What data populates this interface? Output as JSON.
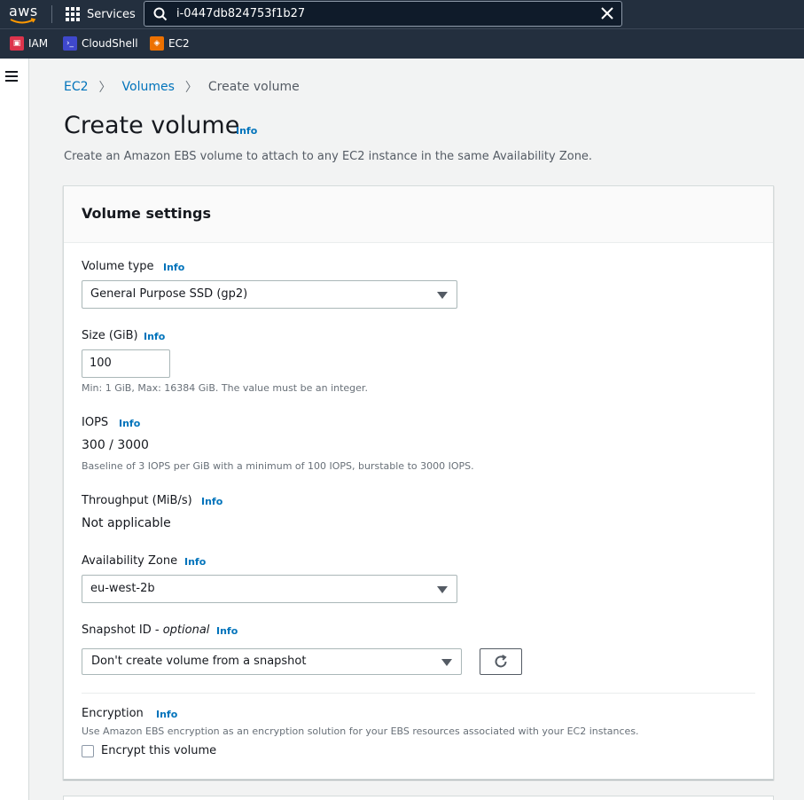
{
  "topnav": {
    "logo_text": "aws",
    "services_label": "Services",
    "search_value": "i-0447db824753f1b27",
    "favorites": [
      {
        "label": "IAM",
        "icon": "iam-icon",
        "color": "#dd344c"
      },
      {
        "label": "CloudShell",
        "icon": "cloudshell-icon",
        "color": "#3f48cc"
      },
      {
        "label": "EC2",
        "icon": "ec2-icon",
        "color": "#ed7100"
      }
    ]
  },
  "breadcrumb": {
    "items": [
      "EC2",
      "Volumes"
    ],
    "current": "Create volume"
  },
  "page": {
    "title": "Create volume",
    "title_info": "Info",
    "description": "Create an Amazon EBS volume to attach to any EC2 instance in the same Availability Zone."
  },
  "panel": {
    "title": "Volume settings",
    "volume_type": {
      "label": "Volume type",
      "info": "Info",
      "value": "General Purpose SSD (gp2)"
    },
    "size": {
      "label": "Size (GiB)",
      "info": "Info",
      "value": "100",
      "hint": "Min: 1 GiB, Max: 16384 GiB. The value must be an integer."
    },
    "iops": {
      "label": "IOPS",
      "info": "Info",
      "value": "300 / 3000",
      "hint": "Baseline of 3 IOPS per GiB with a minimum of 100 IOPS, burstable to 3000 IOPS."
    },
    "throughput": {
      "label": "Throughput (MiB/s)",
      "info": "Info",
      "value": "Not applicable"
    },
    "availability_zone": {
      "label": "Availability Zone",
      "info": "Info",
      "value": "eu-west-2b"
    },
    "snapshot": {
      "label": "Snapshot ID - ",
      "label_optional": "optional",
      "info": "Info",
      "value": "Don't create volume from a snapshot"
    },
    "encryption": {
      "label": "Encryption",
      "info": "Info",
      "hint": "Use Amazon EBS encryption as an encryption solution for your EBS resources associated with your EC2 instances.",
      "checkbox_label": "Encrypt this volume",
      "checked": false
    }
  },
  "colors": {
    "nav_bg": "#232f3e",
    "link": "#0073bb",
    "page_bg": "#f2f3f3"
  }
}
